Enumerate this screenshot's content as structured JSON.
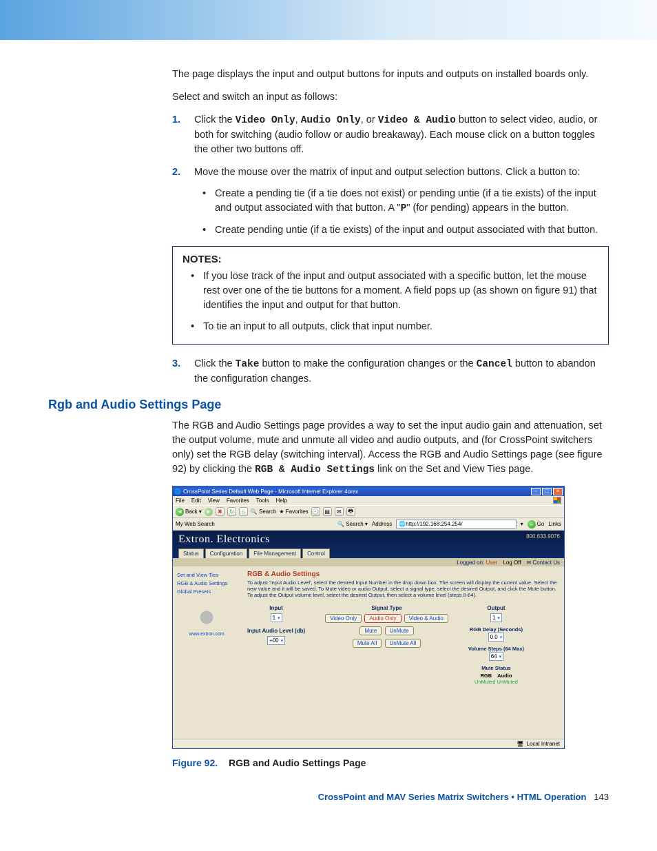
{
  "intro": {
    "p1": "The page displays the input and output buttons for inputs and outputs on installed boards only.",
    "p2": "Select and switch an input as follows:"
  },
  "steps": {
    "s1_a": "Click the ",
    "s1_code1": "Video Only",
    "s1_b": ", ",
    "s1_code2": "Audio Only",
    "s1_c": ", or ",
    "s1_code3": "Video & Audio",
    "s1_d": " button to select video, audio, or both for switching (audio follow or audio breakaway). Each mouse click on a button toggles the other two buttons off.",
    "s2": "Move the mouse over the matrix of input and output selection buttons. Click a button to:",
    "s2_b1_a": "Create a pending tie (if a tie does not exist) or pending untie (if a tie exists) of the input and output associated with that button. A \"",
    "s2_b1_code": "P",
    "s2_b1_b": "\" (for pending) appears in the button.",
    "s2_b2": "Create pending untie (if a tie exists) of the input and output associated with that button.",
    "s3_a": "Click the ",
    "s3_code1": "Take",
    "s3_b": " button to make the configuration changes or the ",
    "s3_code2": "Cancel",
    "s3_c": " button to abandon the configuration changes."
  },
  "notes": {
    "heading": "NOTES:",
    "n1": "If you lose track of the input and output associated with a specific button, let the mouse rest over one of the tie buttons for a moment. A field pops up (as shown on figure 91) that identifies the input and output for that button.",
    "n2": "To tie an input to all outputs, click that input number."
  },
  "section": {
    "title": "Rgb and Audio Settings Page",
    "p_a": "The RGB and Audio Settings page provides a way to set the input audio gain and attenuation, set the output volume, mute and unmute all video and audio outputs, and (for CrossPoint switchers only) set the RGB delay (switching interval). Access the RGB and Audio Settings page (see figure 92) by clicking the ",
    "p_code": "RGB & Audio Settings",
    "p_b": " link on the Set and View Ties page."
  },
  "ie": {
    "title": "CrossPoint Series Default Web Page - Microsoft Internet Explorer 4orex",
    "menus": [
      "File",
      "Edit",
      "View",
      "Favorites",
      "Tools",
      "Help"
    ],
    "back": "Back",
    "search": "Search",
    "favorites": "Favorites",
    "mywebsearch": "My Web Search",
    "searchbtn": "Search",
    "address_label": "Address",
    "url": "http://192.168.254.254/",
    "go": "Go",
    "links": "Links",
    "status": "Local Intranet"
  },
  "ext": {
    "brand": "Extron. Electronics",
    "phone": "800.633.9076",
    "tabs": [
      "Status",
      "Configuration",
      "File Management",
      "Control"
    ],
    "logged": "Logged on:",
    "user": "User",
    "logoff": "Log Off",
    "contact": "Contact Us",
    "side_links": [
      "Set and View Ties",
      "RGB & Audio Settings",
      "Global Presets"
    ],
    "www": "www.extron.com",
    "panel_title": "RGB & Audio Settings",
    "panel_desc": "To adjust 'Input Audio Level', select the desired Input Number in the drop down box. The screen will display the current value. Select the new value and it will be saved. To Mute video or audio Output, select a signal type, select the desired Output, and click the Mute button. To adjust the Output volume level, select the desired Output, then select a volume level (steps 0-64).",
    "col_input": "Input",
    "input_sel": "1",
    "input_audio_label": "Input Audio Level (db)",
    "input_audio_sel": "+00",
    "col_signal": "Signal Type",
    "sig_video": "Video Only",
    "sig_audio": "Audio Only",
    "sig_va": "Video & Audio",
    "mute": "Mute",
    "unmute": "UnMute",
    "muteall": "Mute All",
    "unmuteall": "UnMute All",
    "col_output": "Output",
    "output_sel": "1",
    "rgb_delay": "RGB Delay (Seconds)",
    "rgb_delay_sel": "0.0",
    "vol_steps": "Volume Steps (64 Max)",
    "vol_sel": "64",
    "mute_status": "Mute Status",
    "ms_rgb": "RGB",
    "ms_audio": "Audio",
    "ms_un1": "UnMuted",
    "ms_un2": "UnMuted"
  },
  "caption": {
    "fig": "Figure 92.",
    "text": "RGB and Audio Settings Page"
  },
  "footer": {
    "text": "CrossPoint and MAV Series Matrix Switchers • HTML Operation",
    "page": "143"
  }
}
